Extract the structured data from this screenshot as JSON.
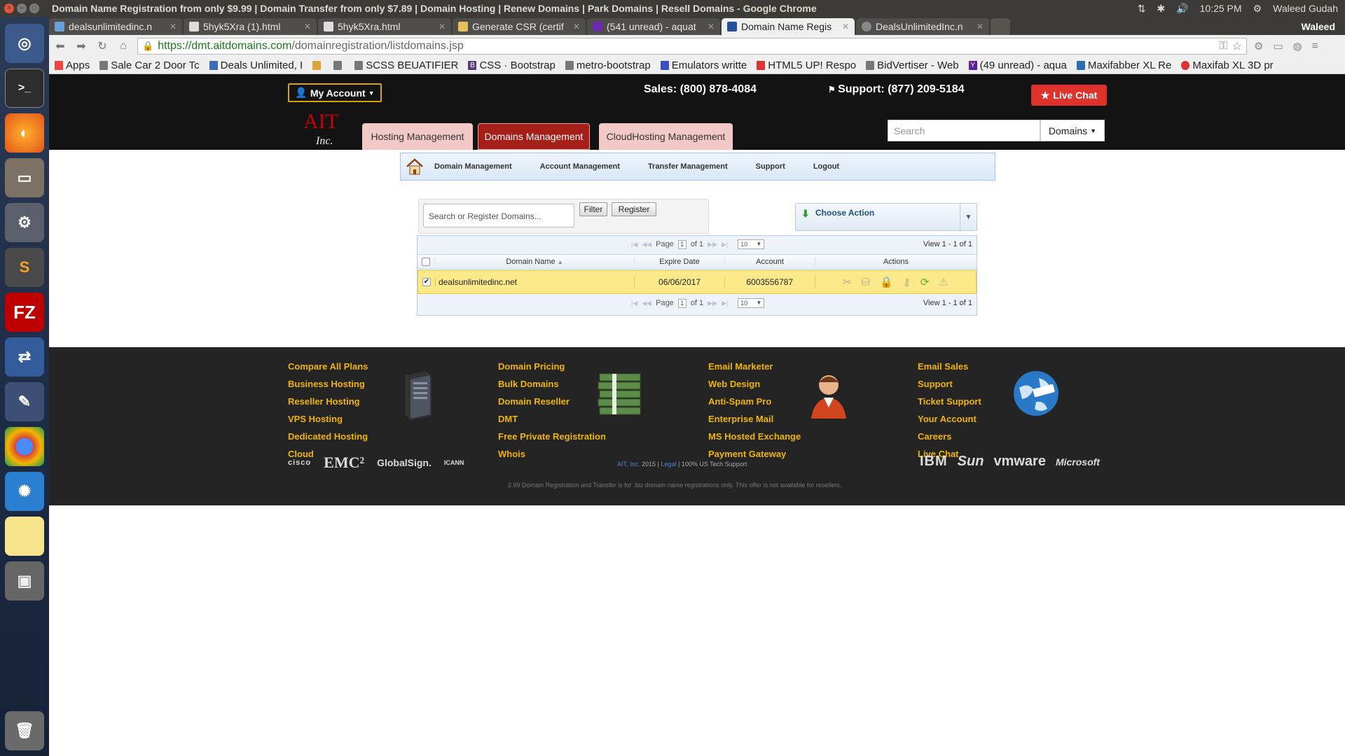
{
  "os": {
    "window_title": "Domain Name Registration from only $9.99 | Domain Transfer from only $7.89 | Domain Hosting | Renew Domains | Park Domains | Resell Domains - Google Chrome",
    "time": "10:25 PM",
    "user": "Waleed Gudah"
  },
  "browser": {
    "tabs": [
      {
        "label": "dealsunlimitedinc.n"
      },
      {
        "label": "5hyk5Xra (1).html"
      },
      {
        "label": "5hyk5Xra.html"
      },
      {
        "label": "Generate CSR (certif"
      },
      {
        "label": "(541 unread) - aquat"
      },
      {
        "label": "Domain Name Regis"
      },
      {
        "label": "DealsUnlimitedInc.n"
      }
    ],
    "profile": "Waleed",
    "url_host": "https://dmt.aitdomains.com",
    "url_path": "/domainregistration/listdomains.jsp",
    "bookmarks": [
      {
        "label": "Apps"
      },
      {
        "label": "Sale Car 2 Door Tc"
      },
      {
        "label": "Deals Unlimited, I"
      },
      {
        "label": ""
      },
      {
        "label": ""
      },
      {
        "label": "SCSS BEUATIFIER"
      },
      {
        "label": "CSS · Bootstrap"
      },
      {
        "label": "metro-bootstrap"
      },
      {
        "label": "Emulators writte"
      },
      {
        "label": "HTML5 UP! Respo"
      },
      {
        "label": "BidVertiser - Web"
      },
      {
        "label": "(49 unread) - aqua"
      },
      {
        "label": "Maxifabber XL Re"
      },
      {
        "label": "Maxifab XL 3D pr"
      }
    ]
  },
  "header": {
    "my_account": "My Account",
    "sales": "Sales: (800) 878-4084",
    "support": "Support: (877) 209-5184",
    "live_chat": "Live Chat",
    "logo_text": "AIT",
    "logo_sub": "Inc.",
    "tabs": [
      {
        "label": "Hosting Management"
      },
      {
        "label": "Domains Management"
      },
      {
        "label": "CloudHosting Management"
      }
    ],
    "search_placeholder": "Search",
    "search_select": "Domains"
  },
  "subnav": {
    "items": [
      {
        "label": "Domain Management"
      },
      {
        "label": "Account Management"
      },
      {
        "label": "Transfer Management"
      },
      {
        "label": "Support"
      },
      {
        "label": "Logout"
      }
    ]
  },
  "toolbar": {
    "search_placeholder": "Search or Register Domains...",
    "filter_label": "Filter",
    "register_label": "Register",
    "choose_action": "Choose Action"
  },
  "grid": {
    "page_label": "Page",
    "page_value": "1",
    "of_label": "of 1",
    "rows_per_page": "10",
    "view_text": "View 1 - 1 of 1",
    "columns": [
      "Domain Name",
      "Expire Date",
      "Account",
      "Actions"
    ],
    "rows": [
      {
        "domain": "dealsunlimitedinc.net",
        "expire": "06/06/2017",
        "account": "6003556787",
        "checked": true
      }
    ]
  },
  "footer": {
    "col1": [
      "Compare All Plans",
      "Business Hosting",
      "Reseller Hosting",
      "VPS Hosting",
      "Dedicated Hosting",
      "Cloud"
    ],
    "col2": [
      "Domain Pricing",
      "Bulk Domains",
      "Domain Reseller",
      "DMT",
      "Free Private Registration",
      "Whois"
    ],
    "col3": [
      "Email Marketer",
      "Web Design",
      "Anti-Spam Pro",
      "Enterprise Mail",
      "MS Hosted Exchange",
      "Payment Gateway"
    ],
    "col4": [
      "Email Sales",
      "Support",
      "Ticket Support",
      "Your Account",
      "Careers",
      "Live Chat"
    ],
    "partners_left": [
      "cisco",
      "EMC²",
      "GlobalSign.",
      "ICANN"
    ],
    "partners_right": [
      "IBM",
      "Sun",
      "vmware",
      "Microsoft"
    ],
    "copyright_company": "AIT, Inc.",
    "copyright_year": "2015 |",
    "copyright_legal": "Legal",
    "copyright_tail": "| 100% US Tech Support",
    "disclaimer": "2.99 Domain Registration and Transfer is for .biz domain name registrations only. This offer is not available for resellers."
  },
  "colors": {
    "accent_gold": "#f0b400",
    "active_tab_red": "#a51e17",
    "live_chat_red": "#e0322d",
    "selected_row": "#fbe98a"
  }
}
